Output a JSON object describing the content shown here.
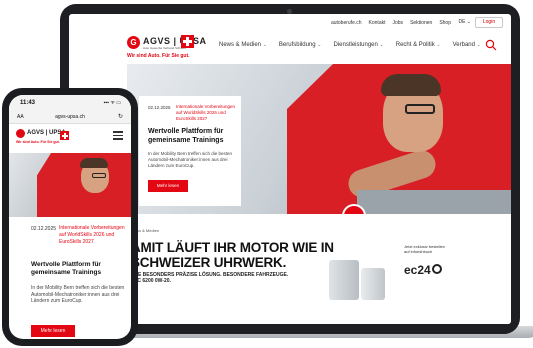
{
  "desktop": {
    "toplinks": [
      "autoberufe.ch",
      "Kontakt",
      "Jobs",
      "Sektionen",
      "Shop"
    ],
    "lang": "DE ⌄",
    "login": "Login",
    "brand": {
      "name": "AGVS | UPSA",
      "sub": "Auto Gewerbe Verband Schweiz",
      "claim": "Wir sind Auto. Für Sie gut."
    },
    "nav": [
      "News & Medien",
      "Berufsbildung",
      "Dienstleistungen",
      "Recht & Politik",
      "Verband"
    ],
    "card": {
      "date": "02.12.2025",
      "kicker": "Internationale Vorbereitungen auf WorldSkills 2026 und EuroSkills 2027",
      "title": "Wertvolle Plattform für gemeinsame Trainings",
      "text": "In der Mobility Bern treffen sich die besten Automobil-Mechatroniker:innen aus drei Ländern zum EuroCup.",
      "button": "Mehr lesen"
    },
    "ad": {
      "small": "News & Medien",
      "headline": "AMIT LÄUFT IHR MOTOR WIE IN SCHWEIZER UHRWERK.",
      "sub": "ERE BESONDERS PRÄZISE LÖSUNG. BESONDERE FAHRZEUGE. TEC 6200 0W-20.",
      "right": "Jetzt exklusiv bestellen auf infoeshbuch",
      "ec": "ec24"
    }
  },
  "phone": {
    "time": "11:43",
    "status": "▪▪▪ ᯤ ▭",
    "url_aa": "AA",
    "url": "agvs-upsa.ch",
    "reload": "↻",
    "brand": {
      "name": "AGVS | UPSA",
      "claim": "Wir sind Auto. Für Sie gut."
    },
    "card": {
      "date": "02.12.2025",
      "kicker": "Internationale Vorbereitungen auf WorldSkills 2026 und EuroSkills 2027",
      "title": "Wertvolle Plattform für gemeinsame Trainings",
      "text": "In der Mobility Bern treffen sich die besten Automobil-Mechatroniker:innen aus drei Ländern zum EuroCup.",
      "button": "Mehr lesen"
    }
  }
}
